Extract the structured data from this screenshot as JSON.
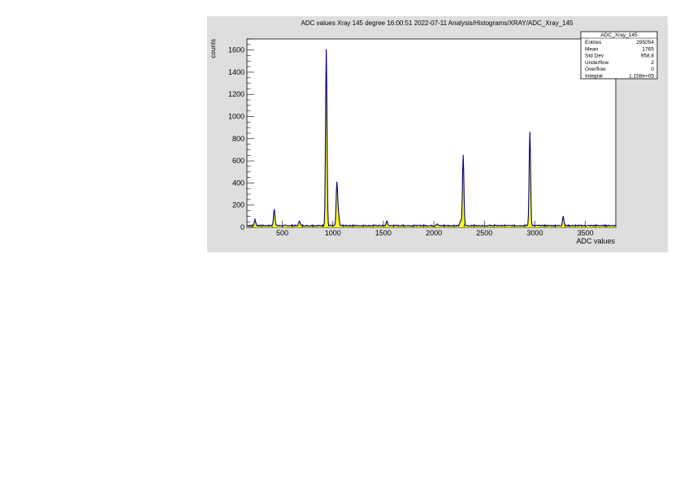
{
  "chart_data": {
    "type": "histogram",
    "title": "ADC values Xray 145 degree  16:00:51  2022-07-11  Analysis/Histograms/XRAY/ADC_Xray_145",
    "xlabel": "ADC values",
    "ylabel": "counts",
    "xlim": [
      150,
      3800
    ],
    "ylim": [
      0,
      1700
    ],
    "x_ticks": [
      500,
      1000,
      1500,
      2000,
      2500,
      3000,
      3500
    ],
    "y_ticks": [
      0,
      200,
      400,
      600,
      800,
      1000,
      1200,
      1400,
      1600
    ],
    "fill_color": "#ffff00",
    "line_color": "#000080",
    "baseline": 15,
    "peaks": [
      {
        "x": 230,
        "y": 70
      },
      {
        "x": 420,
        "y": 165
      },
      {
        "x": 670,
        "y": 60
      },
      {
        "x": 935,
        "y": 1610
      },
      {
        "x": 1040,
        "y": 400
      },
      {
        "x": 1055,
        "y": 120
      },
      {
        "x": 1535,
        "y": 55
      },
      {
        "x": 2030,
        "y": 30
      },
      {
        "x": 2265,
        "y": 60
      },
      {
        "x": 2290,
        "y": 650
      },
      {
        "x": 2950,
        "y": 865
      },
      {
        "x": 3280,
        "y": 100
      }
    ],
    "stats": {
      "name": "ADC_Xray_145",
      "rows": [
        {
          "label": "Entries",
          "value": "295054"
        },
        {
          "label": "Mean",
          "value": "1765"
        },
        {
          "label": "Std Dev",
          "value": "958.8"
        },
        {
          "label": "Underflow",
          "value": "2"
        },
        {
          "label": "Overflow",
          "value": "0"
        },
        {
          "label": "Integral",
          "value": "1.158e+05"
        }
      ]
    }
  }
}
